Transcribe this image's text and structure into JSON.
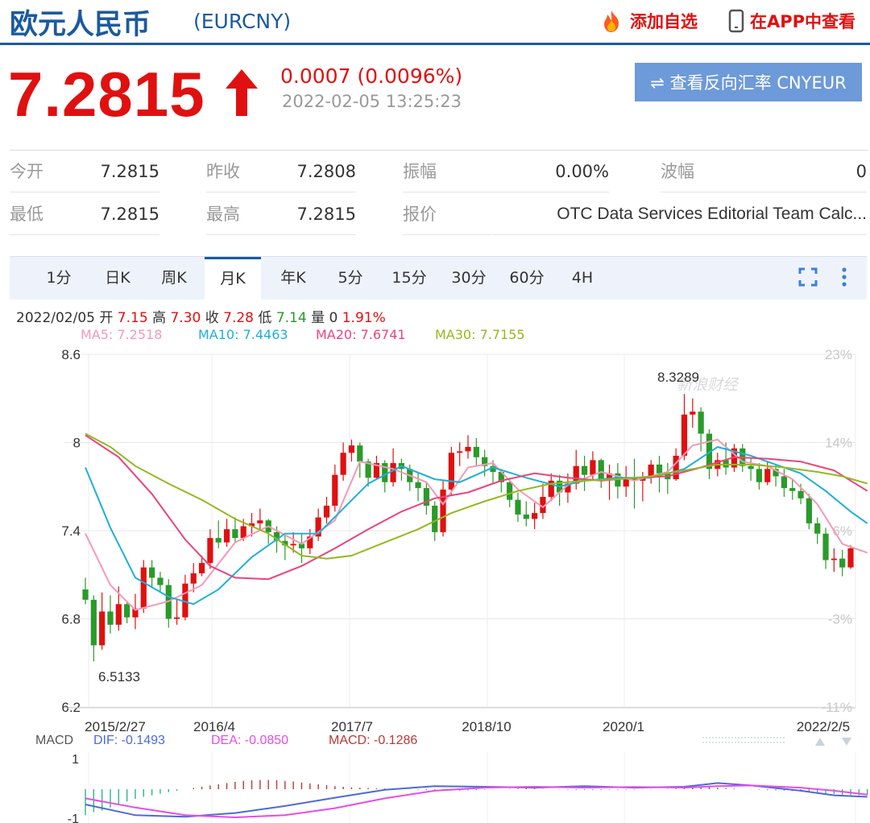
{
  "header": {
    "title": "欧元人民币",
    "code": "(EURCNY)",
    "add_label": "添加自选",
    "app_label": "在APP中查看"
  },
  "quote": {
    "price": "7.2815",
    "change": "0.0007 (0.0096%)",
    "time": "2022-02-05 13:25:23",
    "reverse_label": "⇌ 查看反向汇率 CNYEUR",
    "rows": [
      [
        {
          "label": "今开",
          "value": "7.2815"
        },
        {
          "label": "昨收",
          "value": "7.2808"
        },
        {
          "label": "振幅",
          "value": "0.00%"
        },
        {
          "label": "波幅",
          "value": "0"
        }
      ],
      [
        {
          "label": "最低",
          "value": "7.2815"
        },
        {
          "label": "最高",
          "value": "7.2815"
        },
        {
          "label": "报价",
          "value": "OTC Data Services Editorial Team Calc..."
        }
      ]
    ]
  },
  "tabs": [
    "1分",
    "日K",
    "周K",
    "月K",
    "年K",
    "5分",
    "15分",
    "30分",
    "60分",
    "4H"
  ],
  "active_tab": "月K",
  "info": {
    "date": "2022/02/05",
    "open_label": "开",
    "open": "7.15",
    "high_label": "高",
    "high": "7.30",
    "close_label": "收",
    "close": "7.28",
    "low_label": "低",
    "low": "7.14",
    "vol_label": "量",
    "vol": "0",
    "pct": "1.91%"
  },
  "ma_legend": [
    {
      "text": "MA5: 7.2518",
      "color": "#f39ab6"
    },
    {
      "text": "MA10: 7.4463",
      "color": "#1fb0d6"
    },
    {
      "text": "MA20: 7.6741",
      "color": "#e8457d"
    },
    {
      "text": "MA30: 7.7155",
      "color": "#93b821"
    }
  ],
  "colors": {
    "brand": "#1c5a9e",
    "up": "#e01010",
    "down": "#2a9a2a",
    "button": "#6d9ad8"
  },
  "chart_data": {
    "type": "candlestick",
    "period": "monthly",
    "y_ticks": [
      "8.6",
      "8",
      "7.4",
      "6.8",
      "6.2"
    ],
    "ylim": [
      6.2,
      8.6
    ],
    "pct_ticks": [
      "23%",
      "14%",
      "6%",
      "-3%",
      "-11%"
    ],
    "x_ticks": [
      "2015/2/27",
      "2016/4",
      "2017/7",
      "2018/10",
      "2020/1",
      "2022/2/5"
    ],
    "annotations": [
      {
        "text": "8.3289",
        "value": 8.3289
      },
      {
        "text": "6.5133",
        "value": 6.5133
      }
    ],
    "watermark": "新浪财经",
    "candles": [
      [
        7.0,
        6.93,
        7.08,
        6.9
      ],
      [
        6.93,
        6.62,
        6.96,
        6.51
      ],
      [
        6.62,
        6.85,
        6.98,
        6.59
      ],
      [
        6.85,
        6.76,
        6.96,
        6.7
      ],
      [
        6.76,
        6.9,
        7.02,
        6.72
      ],
      [
        6.9,
        6.81,
        6.92,
        6.77
      ],
      [
        6.81,
        6.87,
        6.97,
        6.73
      ],
      [
        6.87,
        7.15,
        7.2,
        6.84
      ],
      [
        7.15,
        7.08,
        7.2,
        7.01
      ],
      [
        7.08,
        7.03,
        7.12,
        6.98
      ],
      [
        7.03,
        6.8,
        7.07,
        6.74
      ],
      [
        6.8,
        6.81,
        6.93,
        6.76
      ],
      [
        6.81,
        7.04,
        7.1,
        6.79
      ],
      [
        7.04,
        7.11,
        7.18,
        6.98
      ],
      [
        7.11,
        7.18,
        7.23,
        7.09
      ],
      [
        7.18,
        7.35,
        7.41,
        7.14
      ],
      [
        7.35,
        7.32,
        7.47,
        7.28
      ],
      [
        7.32,
        7.41,
        7.48,
        7.29
      ],
      [
        7.41,
        7.35,
        7.49,
        7.32
      ],
      [
        7.35,
        7.43,
        7.48,
        7.33
      ],
      [
        7.43,
        7.45,
        7.52,
        7.36
      ],
      [
        7.45,
        7.47,
        7.55,
        7.41
      ],
      [
        7.47,
        7.39,
        7.48,
        7.31
      ],
      [
        7.39,
        7.33,
        7.43,
        7.25
      ],
      [
        7.33,
        7.3,
        7.37,
        7.2
      ],
      [
        7.3,
        7.31,
        7.39,
        7.25
      ],
      [
        7.31,
        7.28,
        7.38,
        7.18
      ],
      [
        7.28,
        7.36,
        7.41,
        7.24
      ],
      [
        7.36,
        7.49,
        7.55,
        7.33
      ],
      [
        7.49,
        7.57,
        7.63,
        7.45
      ],
      [
        7.57,
        7.78,
        7.85,
        7.53
      ],
      [
        7.78,
        7.93,
        8.0,
        7.74
      ],
      [
        7.93,
        7.98,
        8.02,
        7.87
      ],
      [
        7.98,
        7.87,
        8.0,
        7.76
      ],
      [
        7.87,
        7.76,
        7.89,
        7.7
      ],
      [
        7.76,
        7.86,
        7.91,
        7.75
      ],
      [
        7.86,
        7.73,
        7.88,
        7.66
      ],
      [
        7.73,
        7.86,
        7.96,
        7.7
      ],
      [
        7.86,
        7.82,
        7.89,
        7.74
      ],
      [
        7.82,
        7.73,
        7.85,
        7.67
      ],
      [
        7.73,
        7.69,
        7.79,
        7.6
      ],
      [
        7.69,
        7.57,
        7.73,
        7.51
      ],
      [
        7.57,
        7.39,
        7.6,
        7.33
      ],
      [
        7.39,
        7.68,
        7.74,
        7.36
      ],
      [
        7.68,
        7.93,
        7.97,
        7.64
      ],
      [
        7.93,
        7.94,
        8.0,
        7.84
      ],
      [
        7.94,
        7.97,
        8.05,
        7.89
      ],
      [
        7.97,
        7.9,
        8.03,
        7.84
      ],
      [
        7.9,
        7.84,
        7.95,
        7.77
      ],
      [
        7.84,
        7.8,
        7.88,
        7.72
      ],
      [
        7.8,
        7.73,
        7.82,
        7.66
      ],
      [
        7.73,
        7.61,
        7.76,
        7.56
      ],
      [
        7.61,
        7.51,
        7.66,
        7.46
      ],
      [
        7.51,
        7.48,
        7.6,
        7.43
      ],
      [
        7.48,
        7.52,
        7.59,
        7.41
      ],
      [
        7.52,
        7.63,
        7.72,
        7.48
      ],
      [
        7.63,
        7.74,
        7.79,
        7.6
      ],
      [
        7.74,
        7.66,
        7.78,
        7.57
      ],
      [
        7.66,
        7.72,
        7.79,
        7.59
      ],
      [
        7.72,
        7.84,
        7.95,
        7.68
      ],
      [
        7.84,
        7.78,
        7.91,
        7.67
      ],
      [
        7.78,
        7.88,
        7.94,
        7.74
      ],
      [
        7.88,
        7.75,
        7.89,
        7.69
      ],
      [
        7.75,
        7.79,
        7.85,
        7.61
      ],
      [
        7.79,
        7.7,
        7.86,
        7.62
      ],
      [
        7.7,
        7.76,
        7.84,
        7.63
      ],
      [
        7.76,
        7.74,
        7.89,
        7.55
      ],
      [
        7.74,
        7.76,
        7.8,
        7.6
      ],
      [
        7.76,
        7.85,
        7.88,
        7.72
      ],
      [
        7.85,
        7.79,
        7.91,
        7.66
      ],
      [
        7.79,
        7.75,
        7.86,
        7.65
      ],
      [
        7.75,
        7.91,
        7.96,
        7.74
      ],
      [
        7.91,
        8.19,
        8.33,
        7.88
      ],
      [
        8.19,
        8.21,
        8.3,
        8.1
      ],
      [
        8.21,
        8.06,
        8.24,
        7.94
      ],
      [
        8.06,
        7.82,
        8.09,
        7.75
      ],
      [
        7.82,
        7.88,
        7.93,
        7.77
      ],
      [
        7.88,
        7.83,
        8.0,
        7.78
      ],
      [
        7.83,
        7.96,
        7.99,
        7.8
      ],
      [
        7.96,
        7.84,
        7.99,
        7.8
      ],
      [
        7.84,
        7.82,
        7.89,
        7.74
      ],
      [
        7.82,
        7.73,
        7.86,
        7.68
      ],
      [
        7.73,
        7.82,
        7.87,
        7.71
      ],
      [
        7.82,
        7.77,
        7.85,
        7.7
      ],
      [
        7.77,
        7.69,
        7.82,
        7.63
      ],
      [
        7.69,
        7.67,
        7.75,
        7.61
      ],
      [
        7.67,
        7.62,
        7.72,
        7.58
      ],
      [
        7.62,
        7.45,
        7.65,
        7.41
      ],
      [
        7.45,
        7.38,
        7.49,
        7.31
      ],
      [
        7.38,
        7.2,
        7.42,
        7.14
      ],
      [
        7.2,
        7.21,
        7.28,
        7.12
      ],
      [
        7.21,
        7.15,
        7.27,
        7.09
      ],
      [
        7.15,
        7.28,
        7.3,
        7.14
      ]
    ],
    "ma": {
      "MA5": [
        [
          0,
          7.38
        ],
        [
          3,
          7.03
        ],
        [
          6,
          6.86
        ],
        [
          10,
          6.92
        ],
        [
          14,
          7.03
        ],
        [
          18,
          7.32
        ],
        [
          22,
          7.43
        ],
        [
          26,
          7.31
        ],
        [
          30,
          7.47
        ],
        [
          33,
          7.87
        ],
        [
          37,
          7.82
        ],
        [
          41,
          7.73
        ],
        [
          43,
          7.58
        ],
        [
          46,
          7.83
        ],
        [
          49,
          7.86
        ],
        [
          52,
          7.68
        ],
        [
          55,
          7.56
        ],
        [
          58,
          7.71
        ],
        [
          62,
          7.8
        ],
        [
          66,
          7.74
        ],
        [
          70,
          7.8
        ],
        [
          73,
          7.98
        ],
        [
          76,
          8.02
        ],
        [
          79,
          7.87
        ],
        [
          82,
          7.84
        ],
        [
          85,
          7.75
        ],
        [
          88,
          7.58
        ],
        [
          91,
          7.31
        ],
        [
          94,
          7.25
        ]
      ],
      "MA10": [
        [
          0,
          7.83
        ],
        [
          3,
          7.42
        ],
        [
          6,
          7.08
        ],
        [
          10,
          6.95
        ],
        [
          13,
          6.9
        ],
        [
          16,
          7.0
        ],
        [
          20,
          7.22
        ],
        [
          24,
          7.38
        ],
        [
          28,
          7.38
        ],
        [
          31,
          7.55
        ],
        [
          34,
          7.72
        ],
        [
          38,
          7.84
        ],
        [
          42,
          7.75
        ],
        [
          45,
          7.73
        ],
        [
          49,
          7.83
        ],
        [
          53,
          7.76
        ],
        [
          57,
          7.7
        ],
        [
          60,
          7.74
        ],
        [
          64,
          7.76
        ],
        [
          68,
          7.76
        ],
        [
          72,
          7.82
        ],
        [
          76,
          7.97
        ],
        [
          80,
          7.91
        ],
        [
          83,
          7.85
        ],
        [
          86,
          7.79
        ],
        [
          89,
          7.67
        ],
        [
          92,
          7.53
        ],
        [
          94,
          7.45
        ]
      ],
      "MA20": [
        [
          0,
          8.05
        ],
        [
          4,
          7.9
        ],
        [
          8,
          7.65
        ],
        [
          12,
          7.34
        ],
        [
          15,
          7.16
        ],
        [
          18,
          7.08
        ],
        [
          22,
          7.07
        ],
        [
          26,
          7.16
        ],
        [
          30,
          7.28
        ],
        [
          34,
          7.41
        ],
        [
          38,
          7.53
        ],
        [
          42,
          7.62
        ],
        [
          46,
          7.66
        ],
        [
          50,
          7.74
        ],
        [
          54,
          7.79
        ],
        [
          58,
          7.76
        ],
        [
          62,
          7.74
        ],
        [
          66,
          7.76
        ],
        [
          70,
          7.77
        ],
        [
          74,
          7.83
        ],
        [
          78,
          7.9
        ],
        [
          82,
          7.89
        ],
        [
          86,
          7.87
        ],
        [
          90,
          7.81
        ],
        [
          94,
          7.67
        ]
      ],
      "MA30": [
        [
          0,
          8.06
        ],
        [
          3,
          7.97
        ],
        [
          6,
          7.84
        ],
        [
          10,
          7.72
        ],
        [
          14,
          7.61
        ],
        [
          18,
          7.48
        ],
        [
          22,
          7.38
        ],
        [
          26,
          7.23
        ],
        [
          29,
          7.21
        ],
        [
          32,
          7.23
        ],
        [
          36,
          7.32
        ],
        [
          40,
          7.41
        ],
        [
          44,
          7.52
        ],
        [
          48,
          7.6
        ],
        [
          52,
          7.67
        ],
        [
          56,
          7.72
        ],
        [
          60,
          7.74
        ],
        [
          64,
          7.75
        ],
        [
          68,
          7.77
        ],
        [
          72,
          7.81
        ],
        [
          76,
          7.85
        ],
        [
          80,
          7.85
        ],
        [
          84,
          7.83
        ],
        [
          88,
          7.8
        ],
        [
          91,
          7.77
        ],
        [
          94,
          7.72
        ]
      ]
    },
    "macd_legend": {
      "label": "MACD",
      "dif": "DIF: -0.1493",
      "dea": "DEA: -0.0850",
      "macd": "MACD: -0.1286"
    },
    "macd_y_ticks": [
      "1",
      "-1"
    ],
    "macd_hist": [
      -0.85,
      -0.75,
      -0.7,
      -0.6,
      -0.5,
      -0.4,
      -0.32,
      -0.25,
      -0.2,
      -0.15,
      -0.1,
      -0.05,
      0,
      0.04,
      0.08,
      0.12,
      0.16,
      0.2,
      0.24,
      0.27,
      0.29,
      0.3,
      0.3,
      0.29,
      0.27,
      0.25,
      0.22,
      0.19,
      0.16,
      0.13,
      0.1,
      0.08,
      0.06,
      0.05,
      0.04,
      0.03,
      0.02,
      0.01,
      0,
      -0.01,
      -0.02,
      -0.03,
      -0.04,
      -0.05,
      -0.05,
      -0.05,
      -0.04,
      -0.03,
      -0.02,
      -0.01,
      0,
      0.01,
      0.02,
      0.03,
      0.02,
      0.01,
      0,
      -0.01,
      -0.02,
      -0.03,
      -0.03,
      -0.03,
      -0.03,
      -0.02,
      -0.02,
      -0.02,
      -0.02,
      -0.01,
      -0.01,
      0,
      0.01,
      0.02,
      0.04,
      0.06,
      0.08,
      0.07,
      0.05,
      0.03,
      0.02,
      0,
      -0.01,
      -0.02,
      -0.03,
      -0.04,
      -0.05,
      -0.06,
      -0.08,
      -0.1,
      -0.12,
      -0.14,
      -0.16,
      -0.18,
      -0.19,
      -0.2,
      -0.2
    ],
    "dif": [
      [
        0,
        -0.5
      ],
      [
        6,
        -0.85
      ],
      [
        12,
        -0.9
      ],
      [
        18,
        -0.78
      ],
      [
        24,
        -0.55
      ],
      [
        30,
        -0.28
      ],
      [
        36,
        -0.02
      ],
      [
        42,
        0.1
      ],
      [
        48,
        0.08
      ],
      [
        54,
        0.05
      ],
      [
        60,
        0.1
      ],
      [
        66,
        0.05
      ],
      [
        72,
        0.08
      ],
      [
        76,
        0.2
      ],
      [
        80,
        0.12
      ],
      [
        86,
        -0.05
      ],
      [
        90,
        -0.2
      ],
      [
        94,
        -0.25
      ]
    ],
    "dea": [
      [
        0,
        -0.3
      ],
      [
        6,
        -0.6
      ],
      [
        12,
        -0.85
      ],
      [
        18,
        -0.92
      ],
      [
        24,
        -0.85
      ],
      [
        30,
        -0.62
      ],
      [
        36,
        -0.3
      ],
      [
        42,
        -0.05
      ],
      [
        48,
        0.05
      ],
      [
        54,
        0.08
      ],
      [
        60,
        0.05
      ],
      [
        66,
        0.07
      ],
      [
        72,
        0.05
      ],
      [
        76,
        0.1
      ],
      [
        80,
        0.12
      ],
      [
        86,
        0.05
      ],
      [
        90,
        -0.05
      ],
      [
        94,
        -0.18
      ]
    ],
    "macd_ylim": [
      -1,
      1
    ]
  }
}
